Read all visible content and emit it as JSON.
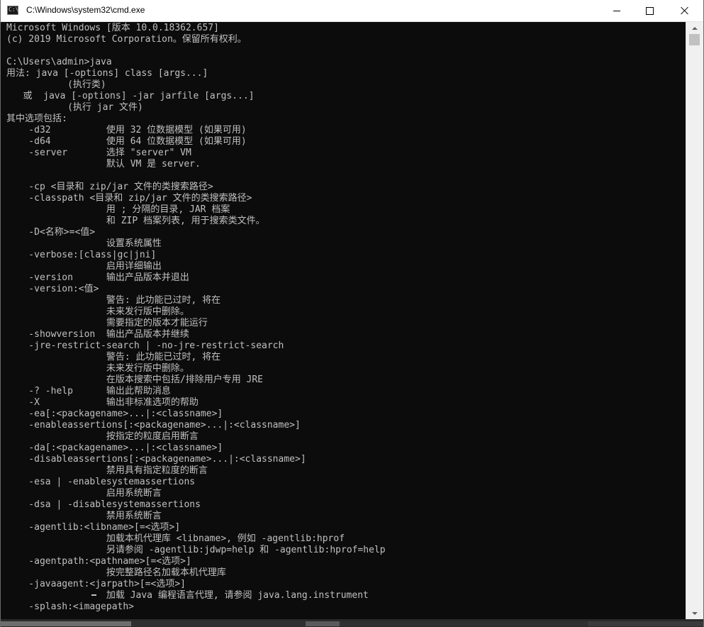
{
  "window": {
    "title": "C:\\Windows\\system32\\cmd.exe",
    "icon_glyph": "C:\\",
    "controls": [
      "minimize-icon",
      "maximize-icon",
      "close-icon"
    ]
  },
  "console": {
    "lines": [
      "Microsoft Windows [版本 10.0.18362.657]",
      "(c) 2019 Microsoft Corporation。保留所有权利。",
      "",
      "C:\\Users\\admin>java",
      "用法: java [-options] class [args...]",
      "           (执行类)",
      "   或  java [-options] -jar jarfile [args...]",
      "           (执行 jar 文件)",
      "其中选项包括:",
      "    -d32          使用 32 位数据模型 (如果可用)",
      "    -d64          使用 64 位数据模型 (如果可用)",
      "    -server       选择 \"server\" VM",
      "                  默认 VM 是 server.",
      "",
      "    -cp <目录和 zip/jar 文件的类搜索路径>",
      "    -classpath <目录和 zip/jar 文件的类搜索路径>",
      "                  用 ; 分隔的目录, JAR 档案",
      "                  和 ZIP 档案列表, 用于搜索类文件。",
      "    -D<名称>=<值>",
      "                  设置系统属性",
      "    -verbose:[class|gc|jni]",
      "                  启用详细输出",
      "    -version      输出产品版本并退出",
      "    -version:<值>",
      "                  警告: 此功能已过时, 将在",
      "                  未来发行版中删除。",
      "                  需要指定的版本才能运行",
      "    -showversion  输出产品版本并继续",
      "    -jre-restrict-search | -no-jre-restrict-search",
      "                  警告: 此功能已过时, 将在",
      "                  未来发行版中删除。",
      "                  在版本搜索中包括/排除用户专用 JRE",
      "    -? -help      输出此帮助消息",
      "    -X            输出非标准选项的帮助",
      "    -ea[:<packagename>...|:<classname>]",
      "    -enableassertions[:<packagename>...|:<classname>]",
      "                  按指定的粒度启用断言",
      "    -da[:<packagename>...|:<classname>]",
      "    -disableassertions[:<packagename>...|:<classname>]",
      "                  禁用具有指定粒度的断言",
      "    -esa | -enablesystemassertions",
      "                  启用系统断言",
      "    -dsa | -disablesystemassertions",
      "                  禁用系统断言",
      "    -agentlib:<libname>[=<选项>]",
      "                  加载本机代理库 <libname>, 例如 -agentlib:hprof",
      "                  另请参阅 -agentlib:jdwp=help 和 -agentlib:hprof=help",
      "    -agentpath:<pathname>[=<选项>]",
      "                  按完整路径名加载本机代理库",
      "    -javaagent:<jarpath>[=<选项>]",
      "                  加载 Java 编程语言代理, 请参阅 java.lang.instrument",
      "    -splash:<imagepath>"
    ]
  },
  "colors": {
    "console_bg": "#0c0c0c",
    "console_fg": "#c0c0c0",
    "titlebar_bg": "#ffffff",
    "scrollbar_bg": "#f0f0f0",
    "scroll_thumb": "#c1c1c1"
  }
}
